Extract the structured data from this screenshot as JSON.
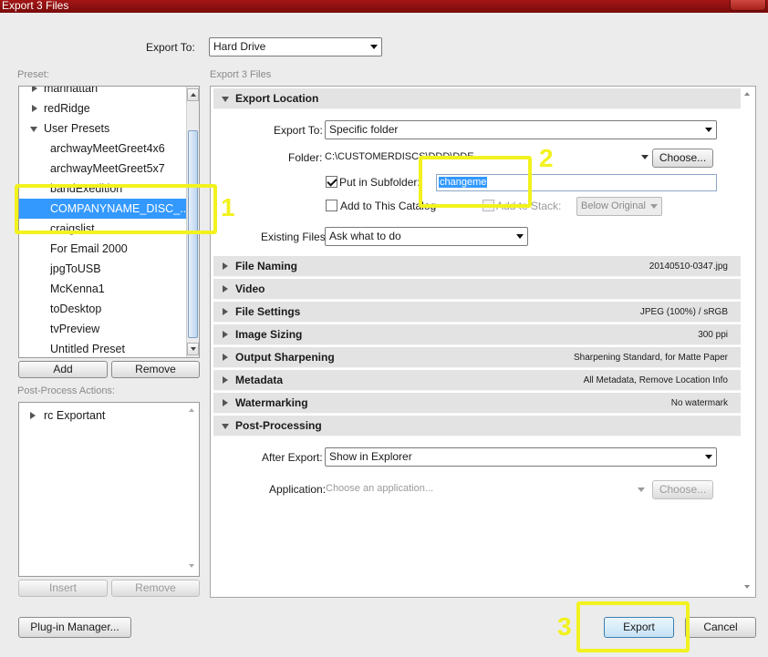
{
  "window": {
    "title": "Export 3 Files"
  },
  "export_to": {
    "label": "Export To:",
    "value": "Hard Drive"
  },
  "preset": {
    "label": "Preset:",
    "items": [
      {
        "label": "manhattan",
        "kind": "folder"
      },
      {
        "label": "redRidge",
        "kind": "folder"
      },
      {
        "label": "User Presets",
        "kind": "folder-open"
      },
      {
        "label": "archwayMeetGreet4x6",
        "kind": "item"
      },
      {
        "label": "archwayMeetGreet5x7",
        "kind": "item"
      },
      {
        "label": "bandExedition",
        "kind": "item"
      },
      {
        "label": "COMPANYNAME_DISC_...",
        "kind": "item",
        "selected": true
      },
      {
        "label": "craigslist",
        "kind": "item"
      },
      {
        "label": "For Email 2000",
        "kind": "item"
      },
      {
        "label": "jpgToUSB",
        "kind": "item"
      },
      {
        "label": "McKenna1",
        "kind": "item"
      },
      {
        "label": "toDesktop",
        "kind": "item"
      },
      {
        "label": "tvPreview",
        "kind": "item"
      },
      {
        "label": "Untitled Preset",
        "kind": "item"
      }
    ],
    "add_label": "Add",
    "remove_label": "Remove"
  },
  "post_process": {
    "label": "Post-Process Actions:",
    "items": [
      {
        "label": "rc Exportant"
      }
    ],
    "insert_label": "Insert",
    "remove_label": "Remove"
  },
  "plugin_manager_label": "Plug-in Manager...",
  "panel": {
    "header": "Export 3 Files",
    "export_location": {
      "title": "Export Location",
      "export_to_label": "Export To:",
      "export_to_value": "Specific folder",
      "folder_label": "Folder:",
      "folder_value": "C:\\CUSTOMERDISCS\\DDD\\DDE",
      "choose_label": "Choose...",
      "subfolder_label": "Put in Subfolder:",
      "subfolder_value": "changeme",
      "add_catalog_label": "Add to This Catalog",
      "add_stack_label": "Add to Stack:",
      "stack_value": "Below Original",
      "existing_label": "Existing Files:",
      "existing_value": "Ask what to do"
    },
    "sections": [
      {
        "title": "File Naming",
        "summary": "20140510-0347.jpg"
      },
      {
        "title": "Video",
        "summary": ""
      },
      {
        "title": "File Settings",
        "summary": "JPEG (100%) / sRGB"
      },
      {
        "title": "Image Sizing",
        "summary": "300 ppi"
      },
      {
        "title": "Output Sharpening",
        "summary": "Sharpening Standard, for Matte Paper"
      },
      {
        "title": "Metadata",
        "summary": "All Metadata, Remove Location Info"
      },
      {
        "title": "Watermarking",
        "summary": "No watermark"
      }
    ],
    "post_processing": {
      "title": "Post-Processing",
      "after_export_label": "After Export:",
      "after_export_value": "Show in Explorer",
      "application_label": "Application:",
      "application_placeholder": "Choose an application...",
      "choose_label": "Choose..."
    }
  },
  "footer": {
    "export_label": "Export",
    "cancel_label": "Cancel"
  },
  "annotations": [
    "1",
    "2",
    "3"
  ],
  "colors": {
    "highlight": "#f2f21e",
    "selection": "#3399ff",
    "titlebar": "#a31515"
  }
}
